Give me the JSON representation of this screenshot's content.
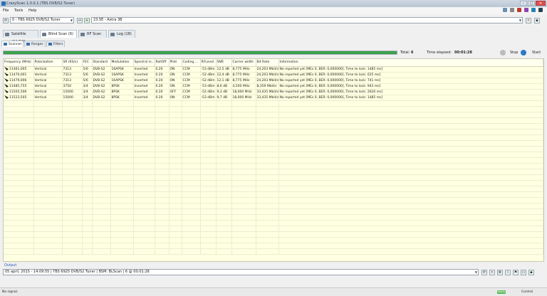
{
  "window": {
    "title": "CrazyScan 1.0.0.1 (TBS DVB/S2 Tuner)"
  },
  "menu": {
    "items": [
      "File",
      "Tools",
      "Help"
    ]
  },
  "tuner": {
    "device": "0 - TBS 6925 DVB/S2 Tuner",
    "satellite": "23.5E - Astra 3B"
  },
  "main_tabs": [
    "Satellite (24.5W)",
    "Blind Scan (6)",
    "RF Scan",
    "Log (18)"
  ],
  "sub_tabs": [
    "Scanner",
    "Ranges",
    "Filters"
  ],
  "scan": {
    "progress": 1.0,
    "total_label": "Total:",
    "total_value": "6",
    "elapsed_label": "Time elapsed:",
    "elapsed_value": "00:01:28",
    "stop_label": "Stop",
    "start_label": "Start"
  },
  "table": {
    "columns": [
      "Frequency (MHz)",
      "Polarization",
      "SR (KS/s)",
      "FEC",
      "Standard",
      "Modulation",
      "Spectral in...",
      "RollOff",
      "Pilot",
      "Coding ...",
      "RFLevel",
      "SNR",
      "Carrier width",
      "Bit Rate",
      "Information"
    ],
    "rows": [
      [
        "11461,005",
        "Vertical",
        "7313",
        "5/6",
        "DVB-S2",
        "16APSK",
        "Inverted",
        "0.20",
        "ON",
        "CCM",
        "-53 dBm",
        "12,5 dB",
        "8,775 MHz",
        "24,203 Mbit/s",
        "No reported yet [MEs 0, BER: 0,000000], Time to lock: 1485 ms]"
      ],
      [
        "11470,001",
        "Vertical",
        "7313",
        "5/6",
        "DVB-S2",
        "16APSK",
        "Inverted",
        "0.20",
        "ON",
        "CCM",
        "-52 dBm",
        "12,4 dB",
        "8,775 MHz",
        "24,203 Mbit/s",
        "No reported yet [MEs 0, BER: 0,000000], Time to lock: 625 ms]"
      ],
      [
        "11479,006",
        "Vertical",
        "7313",
        "5/6",
        "DVB-S2",
        "16APSK",
        "Inverted",
        "0.20",
        "ON",
        "CCM",
        "-52 dBm",
        "12,1 dB",
        "8,775 MHz",
        "24,203 Mbit/s",
        "No reported yet [MEs 0, BER: 0,000000], Time to lock: 741 ms]"
      ],
      [
        "11485,755",
        "Vertical",
        "3750",
        "3/4",
        "DVB-S2",
        "8PSK",
        "Inverted",
        "0.20",
        "ON",
        "CCM",
        "-53 dBm",
        "8,6 dB",
        "4,500 MHz",
        "8,359 Mbit/s",
        "No reported yet [MEs 0, BER: 0,000000], Time to lock: 943 ms]"
      ],
      [
        "11505,506",
        "Vertical",
        "15000",
        "3/4",
        "DVB-S2",
        "8PSK",
        "Inverted",
        "0.20",
        "OFF",
        "CCM",
        "-52 dBm",
        "9,3 dB",
        "18,000 MHz",
        "33,435 Mbit/s",
        "No reported yet [MEs 0, BER: 0,000000], Time to lock: 2620 ms]"
      ],
      [
        "11523,505",
        "Vertical",
        "15000",
        "3/4",
        "DVB-S2",
        "8PSK",
        "Inverted",
        "0.20",
        "ON",
        "CCM",
        "-53 dBm",
        "9,7 dB",
        "18,000 MHz",
        "33,435 Mbit/s",
        "No reported yet [MEs 0, BER: 0,000000], Time to lock: 1485 ms]"
      ]
    ]
  },
  "output": {
    "label": "Output",
    "value": "05 april, 2015 - 14:09:55 | TBS 6925 DVB/S2 Tuner | BSM: BLScan | 6 @ 00:01:28"
  },
  "statusbar": {
    "left": "No signal.",
    "signal": "Ready",
    "control": "Control"
  }
}
